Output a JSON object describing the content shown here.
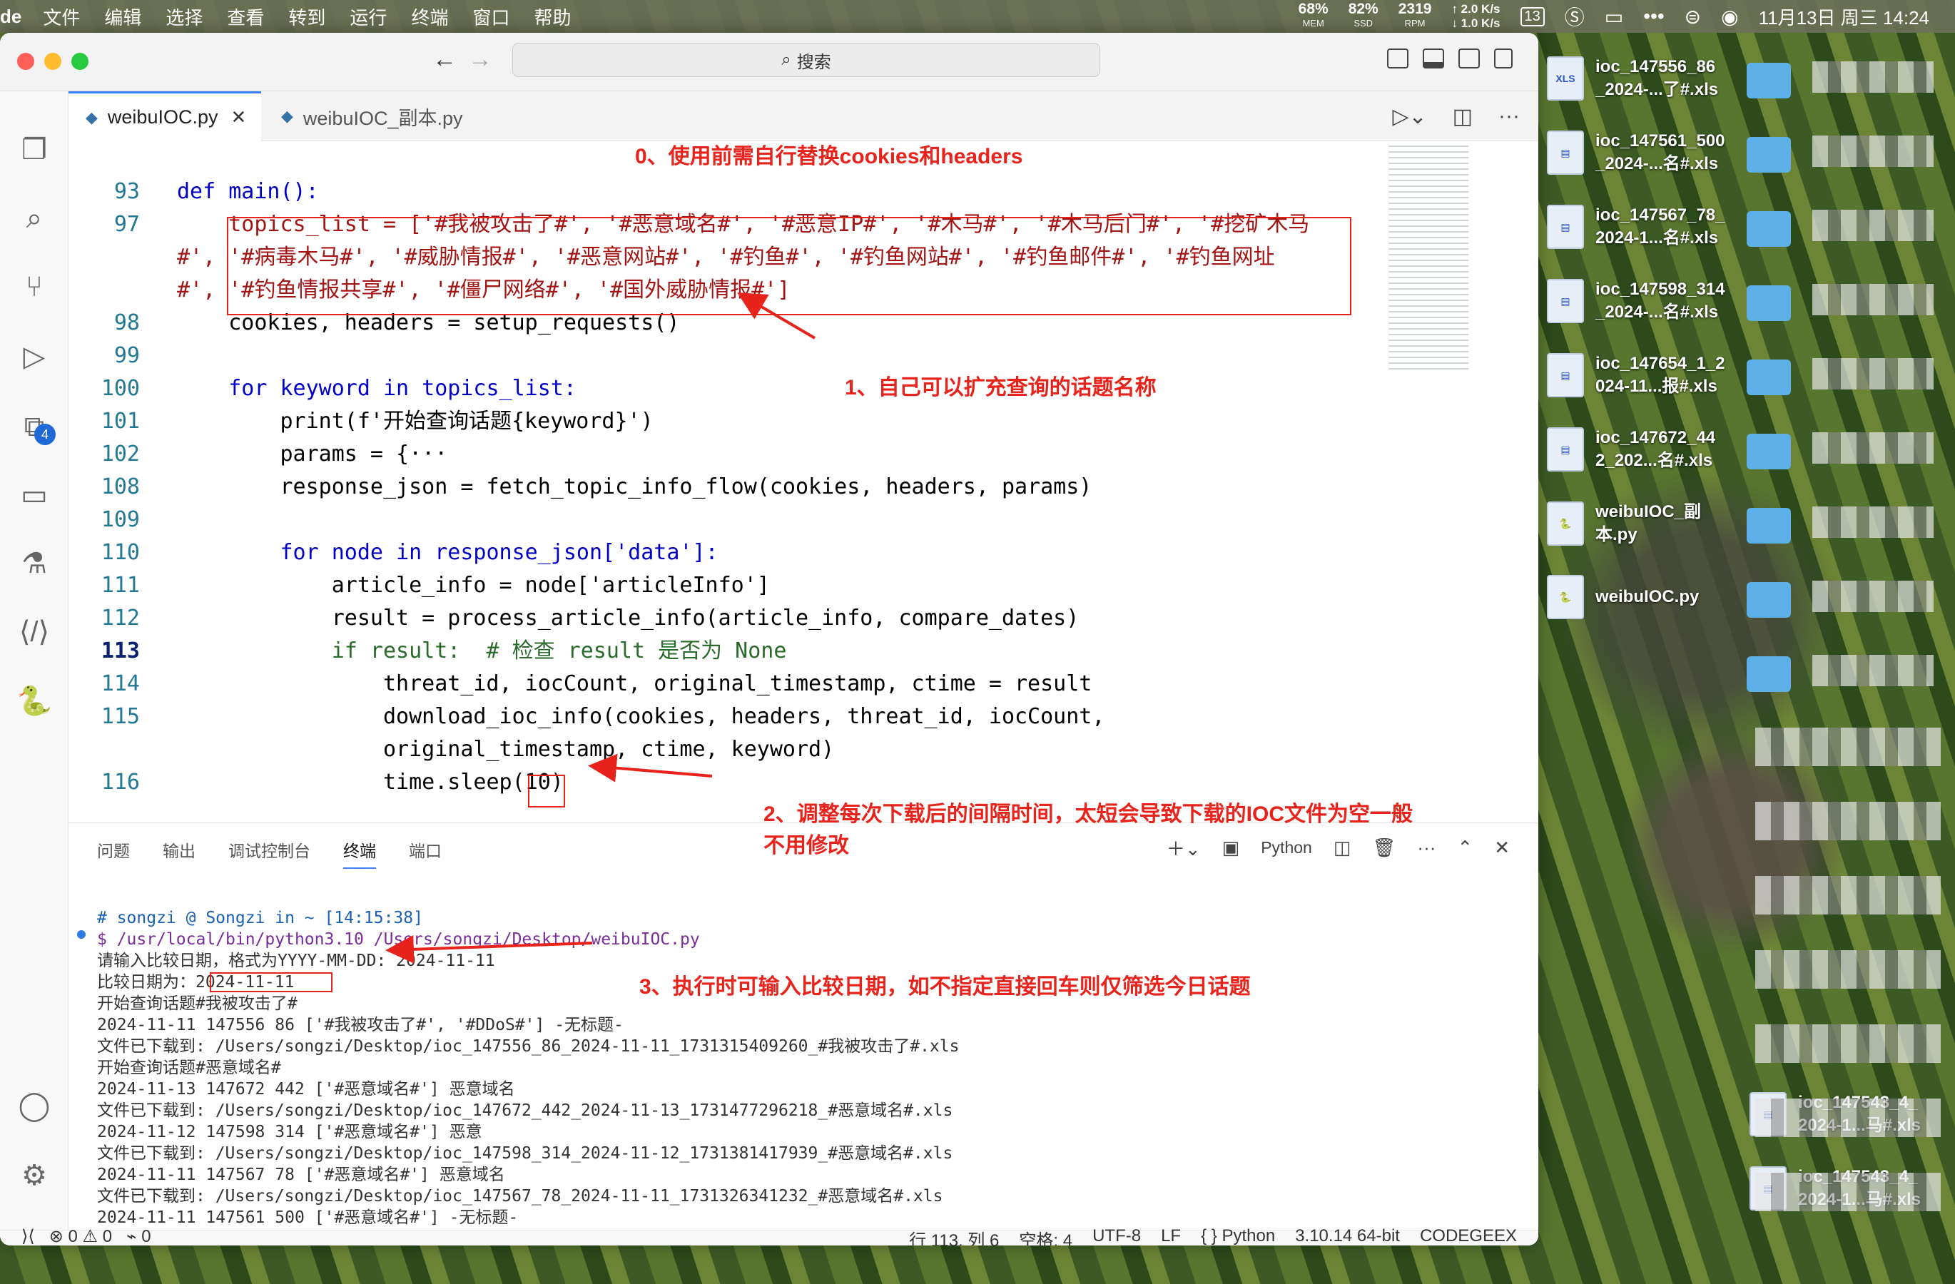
{
  "menubar": {
    "app": "de",
    "items": [
      "文件",
      "编辑",
      "选择",
      "查看",
      "转到",
      "运行",
      "终端",
      "窗口",
      "帮助"
    ],
    "mem": {
      "value": "68%",
      "label": "MEM"
    },
    "ssd": {
      "value": "82%",
      "label": "SSD"
    },
    "rpm": {
      "value": "2319",
      "label": "RPM"
    },
    "net_up": "2.0",
    "net_down": "1.0",
    "net_unit": "K/s",
    "date_badge": "13",
    "clock": "11月13日 周三  14:24"
  },
  "window": {
    "search_placeholder": "搜索"
  },
  "tabs": [
    {
      "label": "weibuIOC.py",
      "active": true
    },
    {
      "label": "weibuIOC_副本.py",
      "active": false
    }
  ],
  "annotations": {
    "a0": "0、使用前需自行替换cookies和headers",
    "a1": "1、自己可以扩充查询的话题名称",
    "a2": "2、调整每次下载后的间隔时间，太短会导致下载的IOC文件为空一般不用修改",
    "a3": "3、执行时可输入比较日期，如不指定直接回车则仅筛选今日话题"
  },
  "code": {
    "lines": [
      {
        "n": "93",
        "t": "def main():"
      },
      {
        "n": "97",
        "t": "    topics_list = ['#我被攻击了#', '#恶意域名#', '#恶意IP#', '#木马#', '#木马后门#', '#挖矿木马"
      },
      {
        "n": "",
        "t": "#', '#病毒木马#', '#威胁情报#', '#恶意网站#', '#钓鱼#', '#钓鱼网站#', '#钓鱼邮件#', '#钓鱼网址"
      },
      {
        "n": "",
        "t": "#', '#钓鱼情报共享#', '#僵尸网络#', '#国外威胁情报#']"
      },
      {
        "n": "98",
        "t": "    cookies, headers = setup_requests()"
      },
      {
        "n": "99",
        "t": ""
      },
      {
        "n": "100",
        "t": "    for keyword in topics_list:"
      },
      {
        "n": "101",
        "t": "        print(f'开始查询话题{keyword}')"
      },
      {
        "n": "102",
        "t": "        params = {···"
      },
      {
        "n": "108",
        "t": "        response_json = fetch_topic_info_flow(cookies, headers, params)"
      },
      {
        "n": "109",
        "t": ""
      },
      {
        "n": "110",
        "t": "        for node in response_json['data']:"
      },
      {
        "n": "111",
        "t": "            article_info = node['articleInfo']"
      },
      {
        "n": "112",
        "t": "            result = process_article_info(article_info, compare_dates)"
      },
      {
        "n": "113",
        "t": "            if result:  # 检查 result 是否为 None"
      },
      {
        "n": "114",
        "t": "                threat_id, iocCount, original_timestamp, ctime = result"
      },
      {
        "n": "115",
        "t": "                download_ioc_info(cookies, headers, threat_id, iocCount,"
      },
      {
        "n": "",
        "t": "                original_timestamp, ctime, keyword)"
      },
      {
        "n": "116",
        "t": "                time.sleep(10)"
      }
    ]
  },
  "panel": {
    "tabs": [
      "问题",
      "输出",
      "调试控制台",
      "终端",
      "端口"
    ],
    "active_tab": "终端",
    "shell": "Python",
    "terminal": [
      "# songzi @ Songzi in ~ [14:15:38]",
      "$ /usr/local/bin/python3.10 /Users/songzi/Desktop/weibuIOC.py",
      "请输入比较日期，格式为YYYY-MM-DD: 2024-11-11",
      "比较日期为：2024-11-11",
      "开始查询话题#我被攻击了#",
      "2024-11-11 147556 86 ['#我被攻击了#', '#DDoS#'] -无标题-",
      "文件已下载到: /Users/songzi/Desktop/ioc_147556_86_2024-11-11_1731315409260_#我被攻击了#.xls",
      "开始查询话题#恶意域名#",
      "2024-11-13 147672 442 ['#恶意域名#'] 恶意域名",
      "文件已下载到: /Users/songzi/Desktop/ioc_147672_442_2024-11-13_1731477296218_#恶意域名#.xls",
      "2024-11-12 147598 314 ['#恶意域名#'] 恶意",
      "文件已下载到: /Users/songzi/Desktop/ioc_147598_314_2024-11-12_1731381417939_#恶意域名#.xls",
      "2024-11-11 147567 78 ['#恶意域名#'] 恶意域名",
      "文件已下载到: /Users/songzi/Desktop/ioc_147567_78_2024-11-11_1731326341232_#恶意域名#.xls",
      "2024-11-11 147561 500 ['#恶意域名#'] -无标题-",
      "文件已下载到: /Users/songzi/Desktop/ioc_147561_500_2024-11-11_1731323280550_#恶意域名#.xls"
    ]
  },
  "statusbar": {
    "errors": "0",
    "warnings": "0",
    "ports": "0",
    "position": "行 113, 列 6",
    "spaces": "空格: 4",
    "encoding": "UTF-8",
    "eol": "LF",
    "language": "{ } Python",
    "interpreter": "3.10.14 64-bit",
    "ext": "CODEGEEX"
  },
  "desktop": [
    {
      "name": "ioc_147556_86_2024-...了#.xls",
      "l1": "ioc_147556_86",
      "l2": "_2024-...了#.xls",
      "type": "xls"
    },
    {
      "name": "ioc_147561_500_2024-...名#.xls",
      "l1": "ioc_147561_500",
      "l2": "_2024-...名#.xls",
      "type": "doc"
    },
    {
      "name": "ioc_147567_78_2024-1...名#.xls",
      "l1": "ioc_147567_78_",
      "l2": "2024-1...名#.xls",
      "type": "doc"
    },
    {
      "name": "ioc_147598_314_2024-...名#.xls",
      "l1": "ioc_147598_314",
      "l2": "_2024-...名#.xls",
      "type": "doc"
    },
    {
      "name": "ioc_147654_1_2024-11...报#.xls",
      "l1": "ioc_147654_1_2",
      "l2": "024-11...报#.xls",
      "type": "doc"
    },
    {
      "name": "ioc_147672_442_202...名#.xls",
      "l1": "ioc_147672_44",
      "l2": "2_202...名#.xls",
      "type": "doc"
    },
    {
      "name": "weibuIOC_副本.py",
      "l1": "weibuIOC_副",
      "l2": "本.py",
      "type": "py"
    },
    {
      "name": "weibuIOC.py",
      "l1": "weibuIOC.py",
      "l2": "",
      "type": "py"
    },
    {
      "name": "ioc_147543_4_2024-1...马#.xls",
      "l1": "ioc_147543_4_",
      "l2": "2024-1...马#.xls",
      "type": "doc"
    },
    {
      "name": "ioc_147543_4_2024-1...马#.xls",
      "l1": "ioc_147543_4_",
      "l2": "2024-1...马#.xls",
      "type": "doc"
    }
  ],
  "colors": {
    "annotation": "#e8231b",
    "accent": "#3b82f6"
  }
}
